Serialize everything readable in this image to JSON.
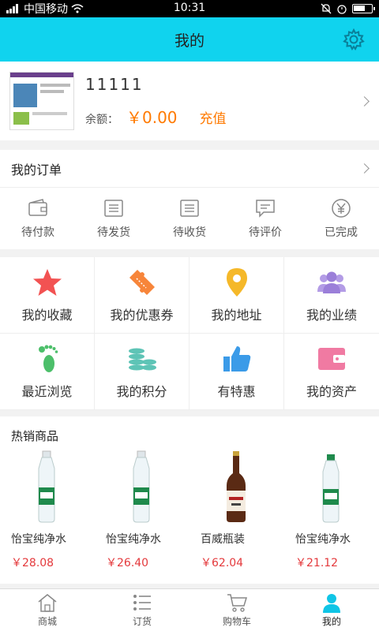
{
  "status_bar": {
    "carrier": "中国移动",
    "time": "10:31"
  },
  "header": {
    "title": "我的"
  },
  "profile": {
    "username": "11111",
    "balance_label": "余额：",
    "balance_value": "￥0.00",
    "recharge_label": "充值"
  },
  "orders": {
    "title": "我的订单",
    "items": [
      {
        "label": "待付款",
        "icon": "wallet-icon"
      },
      {
        "label": "待发货",
        "icon": "document-icon"
      },
      {
        "label": "待收货",
        "icon": "document-icon"
      },
      {
        "label": "待评价",
        "icon": "comment-icon"
      },
      {
        "label": "已完成",
        "icon": "yen-icon"
      }
    ]
  },
  "features": [
    {
      "label": "我的收藏",
      "icon": "star-icon",
      "color": "#f25252"
    },
    {
      "label": "我的优惠券",
      "icon": "coupon-icon",
      "color": "#f7853a"
    },
    {
      "label": "我的地址",
      "icon": "location-pin-icon",
      "color": "#f5b829"
    },
    {
      "label": "我的业绩",
      "icon": "group-icon",
      "color": "#9b7fd9"
    },
    {
      "label": "最近浏览",
      "icon": "footprint-icon",
      "color": "#4cbf6a"
    },
    {
      "label": "我的积分",
      "icon": "coins-icon",
      "color": "#5ec4b6"
    },
    {
      "label": "有特惠",
      "icon": "thumbs-up-icon",
      "color": "#3b9be8"
    },
    {
      "label": "我的资产",
      "icon": "wallet-card-icon",
      "color": "#f07aa2"
    }
  ],
  "hot_products": {
    "title": "热销商品",
    "items": [
      {
        "name": "怡宝纯净水",
        "price": "￥28.08"
      },
      {
        "name": "怡宝纯净水",
        "price": "￥26.40"
      },
      {
        "name": "百威瓶装",
        "price": "￥62.04"
      },
      {
        "name": "怡宝纯净水",
        "price": "￥21.12"
      }
    ]
  },
  "tabbar": [
    {
      "label": "商城",
      "icon": "home-icon"
    },
    {
      "label": "订货",
      "icon": "list-icon"
    },
    {
      "label": "购物车",
      "icon": "cart-icon"
    },
    {
      "label": "我的",
      "icon": "user-icon",
      "active": true
    }
  ],
  "colors": {
    "accent": "#10d3ee",
    "price": "#ff7a00",
    "hot_price": "#e4393c"
  }
}
